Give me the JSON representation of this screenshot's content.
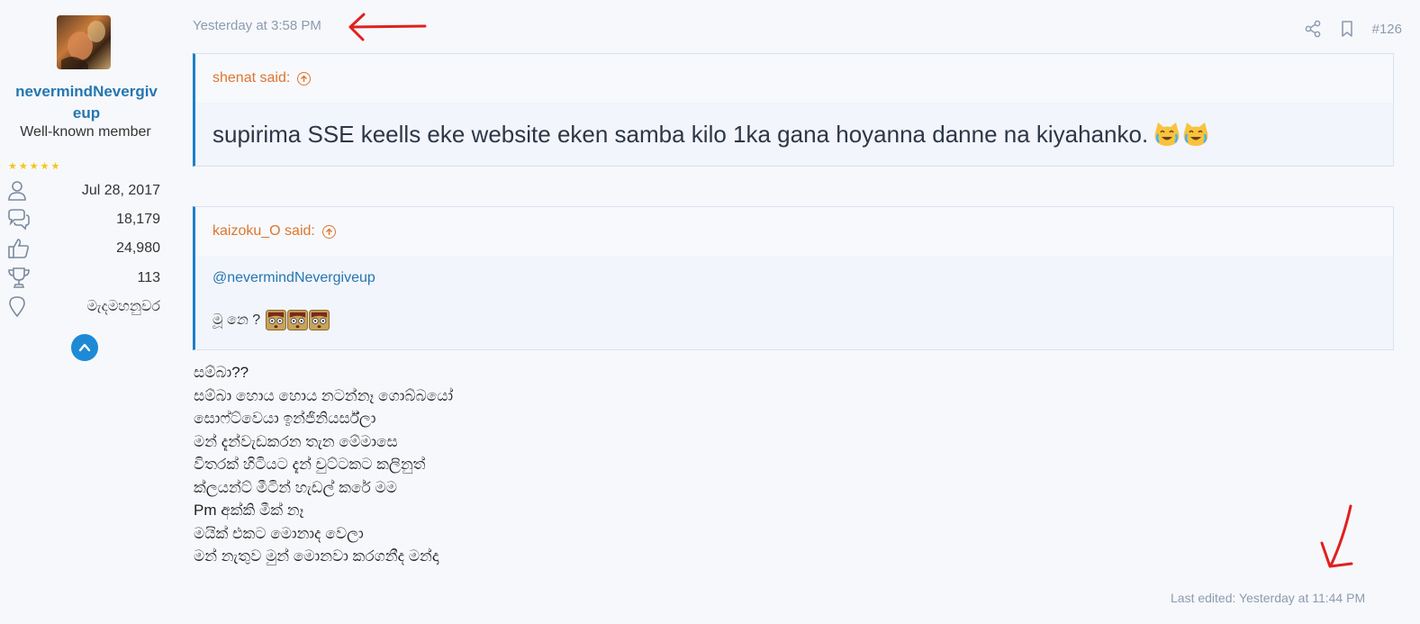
{
  "user": {
    "name": "nevermindNevergiveup",
    "name_line1": "nevermindNevergiv",
    "name_line2": "eup",
    "title": "Well-known member",
    "stars": "★★★★★",
    "stats": [
      {
        "icon": "user-icon",
        "value": "Jul 28, 2017"
      },
      {
        "icon": "messages-icon",
        "value": "18,179"
      },
      {
        "icon": "thumbs-up-icon",
        "value": "24,980"
      },
      {
        "icon": "trophy-icon",
        "value": "113"
      },
      {
        "icon": "location-pin-icon",
        "value": "මැදමහනුවර"
      }
    ]
  },
  "post": {
    "date": "Yesterday at 3:58 PM",
    "number": "#126",
    "quotes": [
      {
        "author_said": "shenat said:",
        "text": "supirima SSE keells eke website eken samba kilo 1ka gana hoyanna danne na kiyahanko."
      },
      {
        "author_said": "kaizoku_O said:",
        "mention": "@nevermindNevergiveup",
        "text": "මූ නෙ ?"
      }
    ],
    "body_lines": [
      "සම්බා??",
      "සම්බා හොය හොය නටන්නෑ ගොබ්බයෝ",
      "සොෆ්ට්වෙයා ඉන්ජිනියර්ස්ලා",
      "මන් දැන්වැඩකරන තැන මේමාසෙ",
      "විතරක් හිටියට දැන් චුට්ටකට කලිනුත්",
      "ක්ලයන්ට් මීටින් හැඩල් කරේ මම",
      "Pm අක්කි මීක් නෑ",
      "මයික් එකට මොනාද වෙලා",
      "මන් නැතුව මුන් මොනවා කරගනීද මන්දා"
    ],
    "last_edited": "Last edited: Yesterday at 11:44 PM"
  },
  "colors": {
    "accent": "#2577b1",
    "quote_author": "#e0752e",
    "muted": "#8c9bb0",
    "annotation_arrow": "#e02020"
  }
}
